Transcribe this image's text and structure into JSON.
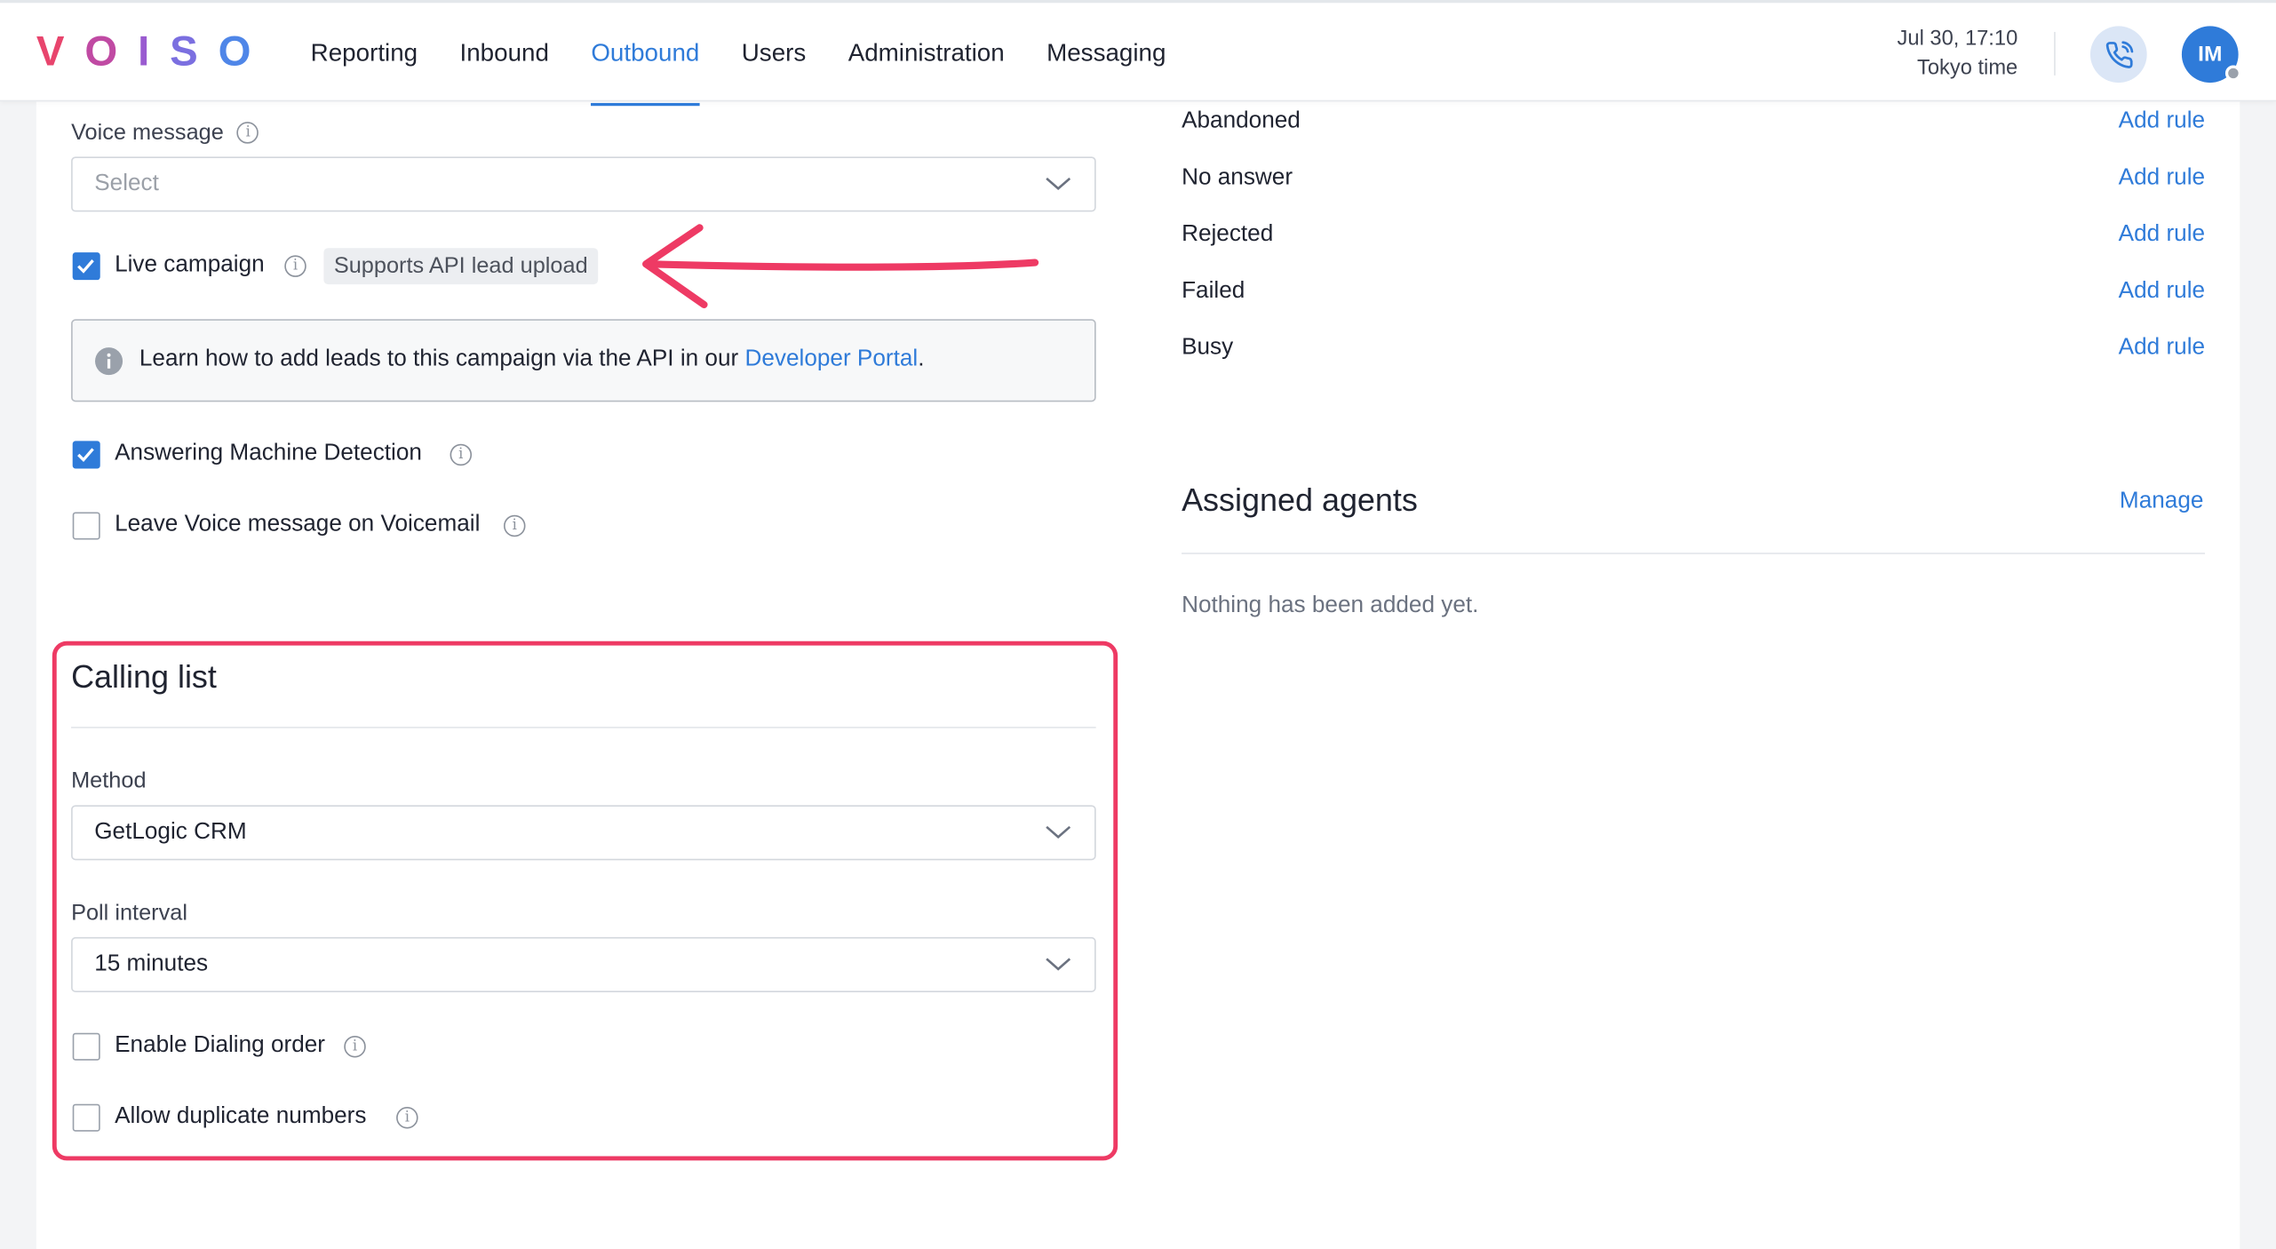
{
  "brand": {
    "logo_letters": [
      "V",
      "O",
      "I",
      "S",
      "O"
    ],
    "logo_colors": [
      "#e8456d",
      "#c04aa3",
      "#9a5bd0",
      "#7b6fe0",
      "#4f86e8"
    ]
  },
  "nav": {
    "items": [
      {
        "label": "Reporting"
      },
      {
        "label": "Inbound"
      },
      {
        "label": "Outbound",
        "active": true
      },
      {
        "label": "Users"
      },
      {
        "label": "Administration"
      },
      {
        "label": "Messaging"
      }
    ]
  },
  "header": {
    "date": "Jul 30, 17:10",
    "timezone": "Tokyo time",
    "avatar_initials": "IM",
    "phone_icon": "phone-call-icon"
  },
  "left": {
    "voice_message": {
      "label": "Voice message",
      "placeholder": "Select"
    },
    "live_campaign": {
      "label": "Live campaign",
      "checked": true,
      "tag": "Supports API lead upload"
    },
    "info_banner": {
      "text_before": "Learn how to add leads to this campaign via the API in our ",
      "link": "Developer Portal",
      "text_after": "."
    },
    "amd": {
      "label": "Answering Machine Detection",
      "checked": true
    },
    "leave_voicemail": {
      "label": "Leave Voice message on Voicemail",
      "checked": false
    },
    "calling_list": {
      "title": "Calling list",
      "method": {
        "label": "Method",
        "value": "GetLogic CRM"
      },
      "poll_interval": {
        "label": "Poll interval",
        "value": "15 minutes"
      },
      "dialing_order": {
        "label": "Enable Dialing order",
        "checked": false
      },
      "duplicates": {
        "label": "Allow duplicate numbers",
        "checked": false
      }
    }
  },
  "right": {
    "rules": [
      {
        "label": "Abandoned",
        "action": "Add rule"
      },
      {
        "label": "No answer",
        "action": "Add rule"
      },
      {
        "label": "Rejected",
        "action": "Add rule"
      },
      {
        "label": "Failed",
        "action": "Add rule"
      },
      {
        "label": "Busy",
        "action": "Add rule"
      }
    ],
    "assigned_agents": {
      "title": "Assigned agents",
      "action": "Manage",
      "empty": "Nothing has been added yet."
    }
  },
  "colors": {
    "accent": "#2f7bd9",
    "annotation": "#ee3a64"
  }
}
